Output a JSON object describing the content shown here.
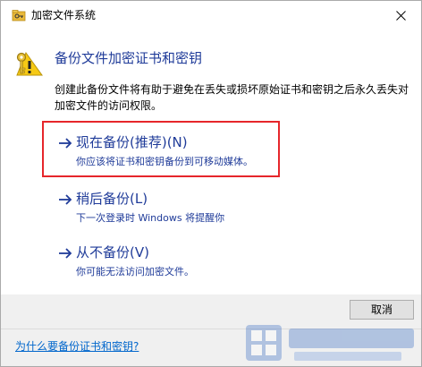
{
  "window": {
    "title": "加密文件系统",
    "icon": "encrypted-folder-key-icon",
    "close_icon": "close-icon"
  },
  "header": {
    "title": "备份文件加密证书和密钥",
    "icon": "certificate-key-icon"
  },
  "description": "创建此备份文件将有助于避免在丢失或损坏原始证书和密钥之后永久丢失对加密文件的访问权限。",
  "options": [
    {
      "title": "现在备份(推荐)(N)",
      "desc": "你应该将证书和密钥备份到可移动媒体。",
      "highlighted": true
    },
    {
      "title": "稍后备份(L)",
      "desc": "下一次登录时 Windows 将提醒你"
    },
    {
      "title": "从不备份(V)",
      "desc": "你可能无法访问加密文件。"
    }
  ],
  "buttons": {
    "cancel": "取消"
  },
  "help_link": "为什么要备份证书和密钥?",
  "colors": {
    "link_blue": "#1f3b99",
    "hyperlink": "#0066cc",
    "highlight_red": "#e6262b"
  }
}
